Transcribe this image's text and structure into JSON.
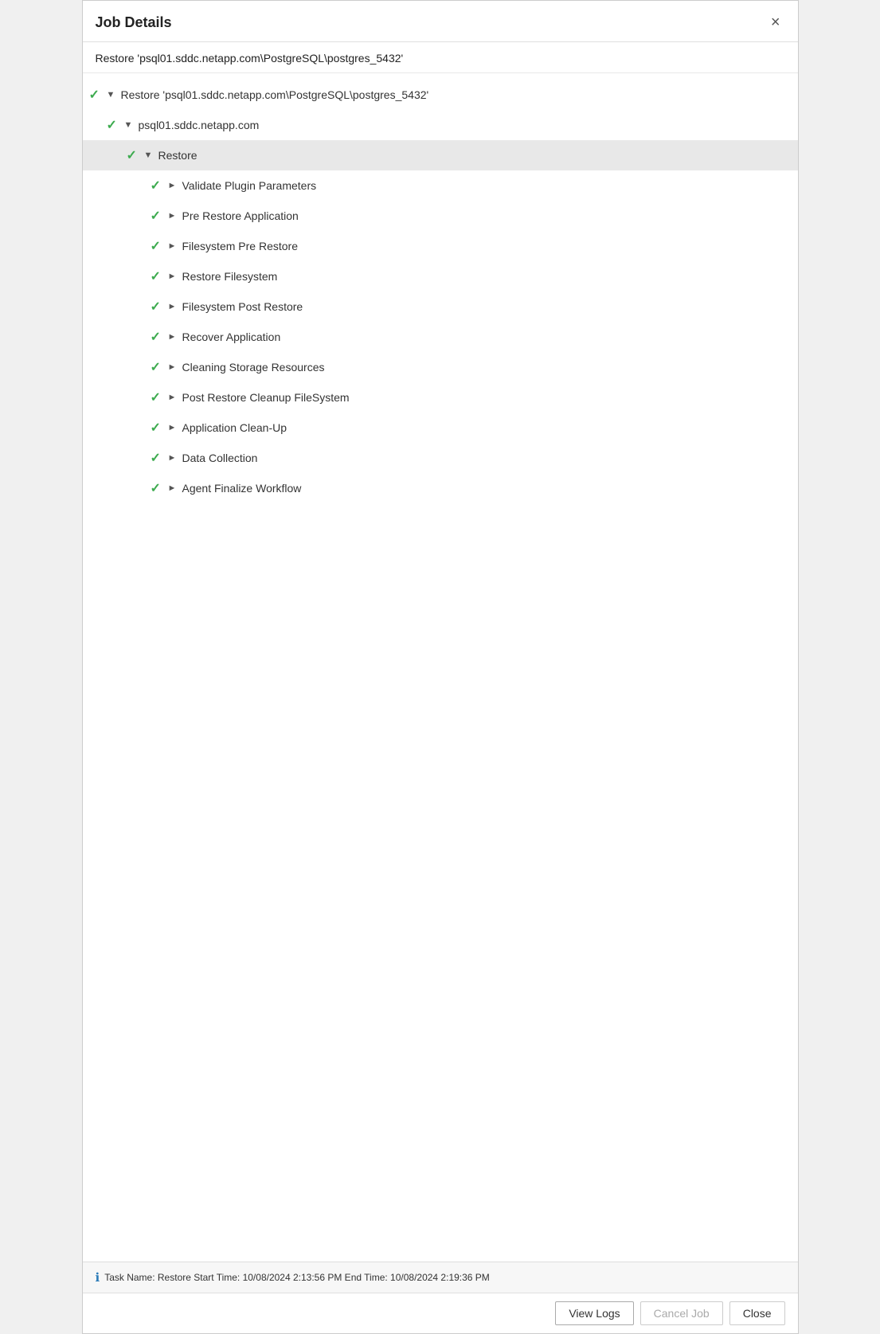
{
  "dialog": {
    "title": "Job Details",
    "subtitle": "Restore 'psql01.sddc.netapp.com\\PostgreSQL\\postgres_5432'",
    "close_label": "×"
  },
  "footer": {
    "info_text": "Task Name: Restore Start Time: 10/08/2024 2:13:56 PM End Time: 10/08/2024 2:19:36 PM"
  },
  "buttons": {
    "view_logs": "View Logs",
    "cancel_job": "Cancel Job",
    "close": "Close"
  },
  "tree": [
    {
      "id": "node-1",
      "level": 1,
      "has_check": true,
      "arrow": "▼",
      "label": "Restore 'psql01.sddc.netapp.com\\PostgreSQL\\postgres_5432'",
      "highlighted": false
    },
    {
      "id": "node-2",
      "level": 2,
      "has_check": true,
      "arrow": "▼",
      "label": "psql01.sddc.netapp.com",
      "highlighted": false
    },
    {
      "id": "node-3",
      "level": 3,
      "has_check": true,
      "arrow": "▼",
      "label": "Restore",
      "highlighted": true
    },
    {
      "id": "node-4",
      "level": 4,
      "has_check": true,
      "arrow": "►",
      "label": "Validate Plugin Parameters",
      "highlighted": false
    },
    {
      "id": "node-5",
      "level": 4,
      "has_check": true,
      "arrow": "►",
      "label": "Pre Restore Application",
      "highlighted": false
    },
    {
      "id": "node-6",
      "level": 4,
      "has_check": true,
      "arrow": "►",
      "label": "Filesystem Pre Restore",
      "highlighted": false
    },
    {
      "id": "node-7",
      "level": 4,
      "has_check": true,
      "arrow": "►",
      "label": "Restore Filesystem",
      "highlighted": false
    },
    {
      "id": "node-8",
      "level": 4,
      "has_check": true,
      "arrow": "►",
      "label": "Filesystem Post Restore",
      "highlighted": false
    },
    {
      "id": "node-9",
      "level": 4,
      "has_check": true,
      "arrow": "►",
      "label": "Recover Application",
      "highlighted": false
    },
    {
      "id": "node-10",
      "level": 4,
      "has_check": true,
      "arrow": "►",
      "label": "Cleaning Storage Resources",
      "highlighted": false
    },
    {
      "id": "node-11",
      "level": 4,
      "has_check": true,
      "arrow": "►",
      "label": "Post Restore Cleanup FileSystem",
      "highlighted": false
    },
    {
      "id": "node-12",
      "level": 4,
      "has_check": true,
      "arrow": "►",
      "label": "Application Clean-Up",
      "highlighted": false
    },
    {
      "id": "node-13",
      "level": 4,
      "has_check": true,
      "arrow": "►",
      "label": "Data Collection",
      "highlighted": false
    },
    {
      "id": "node-14",
      "level": 4,
      "has_check": true,
      "arrow": "►",
      "label": "Agent Finalize Workflow",
      "highlighted": false
    }
  ]
}
